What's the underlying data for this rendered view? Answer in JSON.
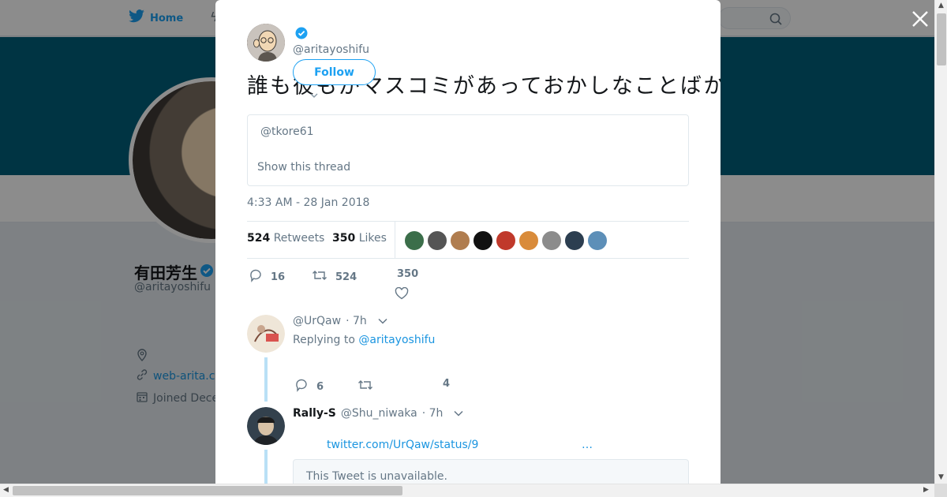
{
  "background": {
    "nav_home": "Home",
    "profile_name": "有田芳生",
    "profile_handle": "@aritayoshifu",
    "website": "web-arita.co",
    "joined": "Joined Dece"
  },
  "tweet": {
    "handle": "@aritayoshifu",
    "follow_label": "Follow",
    "text": "誰も彼もがマスコミがあっておかしなことばかりだと思います日本の政治はどうなってしまうのかを",
    "quote_handle": "@tkore61",
    "show_thread": "Show this thread",
    "timestamp": "4:33 AM - 28 Jan 2018",
    "retweets_count": "524",
    "retweets_label": "Retweets",
    "likes_count": "350",
    "likes_label": "Likes",
    "reply_count": "16",
    "retweet_count": "524",
    "like_count": "350"
  },
  "likers": [
    {
      "name": "liker-1",
      "color": "#3b6e4a"
    },
    {
      "name": "liker-2",
      "color": "#555555"
    },
    {
      "name": "liker-3",
      "color": "#b07d4f"
    },
    {
      "name": "liker-4",
      "color": "#111111"
    },
    {
      "name": "liker-5",
      "color": "#c0392b"
    },
    {
      "name": "liker-6",
      "color": "#d98b3a"
    },
    {
      "name": "liker-7",
      "color": "#8c8c8c"
    },
    {
      "name": "liker-8",
      "color": "#2c3e50"
    },
    {
      "name": "liker-9",
      "color": "#5d8fb8"
    }
  ],
  "replies": [
    {
      "name": "",
      "handle": "@UrQaw",
      "time": "· 7h",
      "replying_prefix": "Replying to",
      "replying_to": "@aritayoshifu",
      "reply_count": "6",
      "retweet_count": "",
      "like_count": "4"
    },
    {
      "name": "Rally-S",
      "handle": "@Shu_niwaka",
      "time": "· 7h",
      "link": "twitter.com/UrQaw/status/9",
      "ellipsis": "…",
      "unavailable": "This Tweet is unavailable."
    }
  ],
  "colors": {
    "accent": "#1da1f2",
    "link": "#1b95e0",
    "banner": "#005f7a",
    "thread_line": "#b9e0f6"
  }
}
